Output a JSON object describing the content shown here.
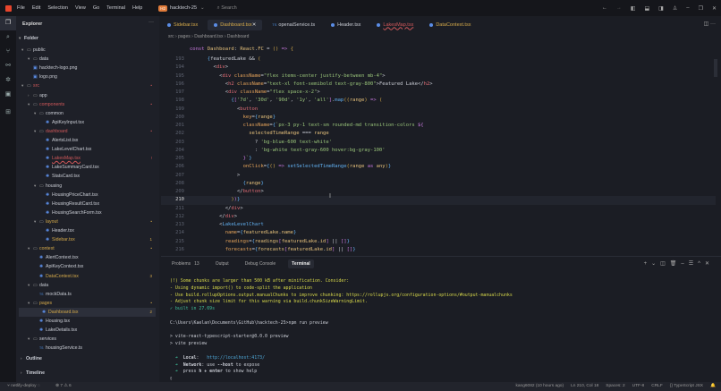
{
  "titlebar": {
    "menus": [
      "File",
      "Edit",
      "Selection",
      "View",
      "Go",
      "Terminal",
      "Help"
    ],
    "project_badge": "H2",
    "project": "hacktech-25",
    "search": "Search"
  },
  "explorer": {
    "title": "Explorer",
    "more": "···",
    "folder": "Folder",
    "outline": "Outline",
    "timeline": "Timeline",
    "rows": [
      {
        "d": 0,
        "t": "folder",
        "l": "public",
        "c": "#c9ccd4"
      },
      {
        "d": 1,
        "t": "folder",
        "l": "data",
        "c": "#c9ccd4"
      },
      {
        "d": 1,
        "t": "img",
        "l": "hacktech-logo.png",
        "c": "#c9ccd4"
      },
      {
        "d": 1,
        "t": "img",
        "l": "logo.png",
        "c": "#c9ccd4"
      },
      {
        "d": 0,
        "t": "folder",
        "l": "src",
        "c": "#d0585a",
        "b": "•"
      },
      {
        "d": 1,
        "t": "folderc",
        "l": "app",
        "c": "#c9ccd4"
      },
      {
        "d": 1,
        "t": "folder",
        "l": "components",
        "c": "#d0585a",
        "b": "•"
      },
      {
        "d": 2,
        "t": "folder",
        "l": "common",
        "c": "#c9ccd4"
      },
      {
        "d": 3,
        "t": "tsx",
        "l": "ApiKeyInput.tsx",
        "c": "#c9ccd4"
      },
      {
        "d": 2,
        "t": "folder",
        "l": "dashboard",
        "c": "#d0585a",
        "b": "•"
      },
      {
        "d": 3,
        "t": "tsx",
        "l": "AlertsList.tsx",
        "c": "#c9ccd4"
      },
      {
        "d": 3,
        "t": "tsx",
        "l": "LakeLevelChart.tsx",
        "c": "#c9ccd4"
      },
      {
        "d": 3,
        "t": "tsx",
        "l": "LakesMap.tsx",
        "c": "#d0585a",
        "b": "!"
      },
      {
        "d": 3,
        "t": "tsx",
        "l": "LakeSummaryCard.tsx",
        "c": "#c9ccd4"
      },
      {
        "d": 3,
        "t": "tsx",
        "l": "StatsCard.tsx",
        "c": "#c9ccd4"
      },
      {
        "d": 2,
        "t": "folder",
        "l": "housing",
        "c": "#c9ccd4"
      },
      {
        "d": 3,
        "t": "tsx",
        "l": "HousingPriceChart.tsx",
        "c": "#c9ccd4"
      },
      {
        "d": 3,
        "t": "tsx",
        "l": "HousingResultCard.tsx",
        "c": "#c9ccd4"
      },
      {
        "d": 3,
        "t": "tsx",
        "l": "HousingSearchForm.tsx",
        "c": "#c9ccd4"
      },
      {
        "d": 2,
        "t": "folder",
        "l": "layout",
        "c": "#d4a94a",
        "b": "•"
      },
      {
        "d": 3,
        "t": "tsx",
        "l": "Header.tsx",
        "c": "#c9ccd4"
      },
      {
        "d": 3,
        "t": "tsx",
        "l": "Sidebar.tsx",
        "c": "#d4a94a",
        "b": "1"
      },
      {
        "d": 1,
        "t": "folder",
        "l": "context",
        "c": "#d4a94a",
        "b": "•"
      },
      {
        "d": 2,
        "t": "tsx",
        "l": "AlertContext.tsx",
        "c": "#c9ccd4"
      },
      {
        "d": 2,
        "t": "tsx",
        "l": "ApiKeyContext.tsx",
        "c": "#c9ccd4"
      },
      {
        "d": 2,
        "t": "tsx",
        "l": "DataContext.tsx",
        "c": "#d4a94a",
        "b": "3"
      },
      {
        "d": 1,
        "t": "folder",
        "l": "data",
        "c": "#c9ccd4"
      },
      {
        "d": 2,
        "t": "ts",
        "l": "mockData.ts",
        "c": "#c9ccd4"
      },
      {
        "d": 1,
        "t": "folder",
        "l": "pages",
        "c": "#d4a94a",
        "b": "•"
      },
      {
        "d": 2,
        "t": "tsx",
        "l": "Dashboard.tsx",
        "c": "#d4a94a",
        "b": "2",
        "sel": true
      },
      {
        "d": 2,
        "t": "tsx",
        "l": "Housing.tsx",
        "c": "#c9ccd4"
      },
      {
        "d": 2,
        "t": "tsx",
        "l": "LakeDetails.tsx",
        "c": "#c9ccd4"
      },
      {
        "d": 1,
        "t": "folder",
        "l": "services",
        "c": "#c9ccd4"
      },
      {
        "d": 2,
        "t": "ts",
        "l": "housingService.ts",
        "c": "#c9ccd4"
      }
    ]
  },
  "tabs": [
    {
      "l": "Sidebar.tsx",
      "c": "#d4a94a",
      "i": "tsx"
    },
    {
      "l": "Dashboard.tsx",
      "c": "#d4a94a",
      "i": "tsx",
      "active": true
    },
    {
      "l": "openaiService.ts",
      "c": "#c9ccd4",
      "i": "ts"
    },
    {
      "l": "Header.tsx",
      "c": "#c9ccd4",
      "i": "tsx"
    },
    {
      "l": "LakesMap.tsx",
      "c": "#d0585a",
      "i": "tsx"
    },
    {
      "l": "DataContext.tsx",
      "c": "#d4a94a",
      "i": "tsx"
    }
  ],
  "breadcrumb": [
    "src",
    "pages",
    "Dashboard.tsx",
    "Dashboard"
  ],
  "code": {
    "sticky": [
      [
        "kw",
        "const "
      ],
      [
        "vr",
        "Dashboard"
      ],
      [
        "pl",
        ": "
      ],
      [
        "vr",
        "React"
      ],
      [
        "pl",
        "."
      ],
      [
        "vr",
        "FC"
      ],
      [
        "pl",
        " = "
      ],
      [
        "br",
        "()"
      ],
      [
        "kw",
        " => "
      ],
      [
        "br",
        "{"
      ]
    ],
    "lines": [
      {
        "n": "193",
        "i": 6,
        "t": [
          [
            "fn",
            "{"
          ],
          [
            "pl",
            "featuredLake && "
          ],
          [
            "br",
            "("
          ]
        ]
      },
      {
        "n": "194",
        "i": 8,
        "t": [
          [
            "pn",
            "<"
          ],
          [
            "tg",
            "div"
          ],
          [
            "pn",
            ">"
          ]
        ]
      },
      {
        "n": "195",
        "i": 10,
        "t": [
          [
            "pn",
            "<"
          ],
          [
            "tg",
            "div "
          ],
          [
            "at",
            "className"
          ],
          [
            "pn",
            "="
          ],
          [
            "st",
            "\"flex items-center justify-between mb-4\""
          ],
          [
            "pn",
            ">"
          ]
        ]
      },
      {
        "n": "196",
        "i": 12,
        "t": [
          [
            "pn",
            "<"
          ],
          [
            "tg",
            "h2 "
          ],
          [
            "at",
            "className"
          ],
          [
            "pn",
            "="
          ],
          [
            "st",
            "\"text-xl font-semibold text-gray-800\""
          ],
          [
            "pn",
            ">Featured Lake</"
          ],
          [
            "tg",
            "h2"
          ],
          [
            "pn",
            ">"
          ]
        ]
      },
      {
        "n": "197",
        "i": 12,
        "t": [
          [
            "pn",
            "<"
          ],
          [
            "tg",
            "div "
          ],
          [
            "at",
            "className"
          ],
          [
            "pn",
            "="
          ],
          [
            "st",
            "\"flex space-x-2\""
          ],
          [
            "pn",
            ">"
          ]
        ]
      },
      {
        "n": "198",
        "i": 14,
        "t": [
          [
            "fn",
            "{"
          ],
          [
            "kw",
            "["
          ],
          [
            "st",
            "'7d'"
          ],
          [
            "pl",
            ", "
          ],
          [
            "st",
            "'30d'"
          ],
          [
            "pl",
            ", "
          ],
          [
            "st",
            "'90d'"
          ],
          [
            "pl",
            ", "
          ],
          [
            "st",
            "'1y'"
          ],
          [
            "pl",
            ", "
          ],
          [
            "st",
            "'all'"
          ],
          [
            "kw",
            "]"
          ],
          [
            "pl",
            "."
          ],
          [
            "fn",
            "map"
          ],
          [
            "br",
            "(("
          ],
          [
            "vr",
            "range"
          ],
          [
            "br",
            ")"
          ],
          [
            "kw",
            " => "
          ],
          [
            "br",
            "("
          ]
        ]
      },
      {
        "n": "199",
        "i": 16,
        "t": [
          [
            "pn",
            "<"
          ],
          [
            "tg",
            "button"
          ]
        ]
      },
      {
        "n": "200",
        "i": 18,
        "t": [
          [
            "at",
            "key"
          ],
          [
            "pn",
            "="
          ],
          [
            "fn",
            "{"
          ],
          [
            "vr",
            "range"
          ],
          [
            "fn",
            "}"
          ]
        ]
      },
      {
        "n": "201",
        "i": 18,
        "t": [
          [
            "at",
            "className"
          ],
          [
            "pn",
            "="
          ],
          [
            "fn",
            "{"
          ],
          [
            "st",
            "`px-3 py-1 text-sm rounded-md transition-colors "
          ],
          [
            "kw",
            "${"
          ]
        ]
      },
      {
        "n": "202",
        "i": 20,
        "t": [
          [
            "vr",
            "selectedTimeRange"
          ],
          [
            "pl",
            " === "
          ],
          [
            "vr",
            "range"
          ]
        ]
      },
      {
        "n": "203",
        "i": 22,
        "t": [
          [
            "pl",
            "? "
          ],
          [
            "st",
            "'bg-blue-600 text-white'"
          ]
        ]
      },
      {
        "n": "204",
        "i": 22,
        "t": [
          [
            "pl",
            ": "
          ],
          [
            "st",
            "'bg-white text-gray-600 hover:bg-gray-100'"
          ]
        ]
      },
      {
        "n": "205",
        "i": 18,
        "t": [
          [
            "kw",
            "}"
          ],
          [
            "st",
            "`"
          ],
          [
            "fn",
            "}"
          ]
        ]
      },
      {
        "n": "206",
        "i": 18,
        "t": [
          [
            "at",
            "onClick"
          ],
          [
            "pn",
            "="
          ],
          [
            "fn",
            "{"
          ],
          [
            "br",
            "()"
          ],
          [
            "kw",
            " => "
          ],
          [
            "fn",
            "setSelectedTimeRange"
          ],
          [
            "br",
            "("
          ],
          [
            "vr",
            "range "
          ],
          [
            "kw",
            "as "
          ],
          [
            "vr",
            "any"
          ],
          [
            "br",
            ")"
          ],
          [
            "fn",
            "}"
          ]
        ]
      },
      {
        "n": "207",
        "i": 16,
        "t": [
          [
            "pn",
            ">"
          ]
        ]
      },
      {
        "n": "208",
        "i": 18,
        "t": [
          [
            "fn",
            "{"
          ],
          [
            "vr",
            "range"
          ],
          [
            "fn",
            "}"
          ]
        ]
      },
      {
        "n": "209",
        "i": 16,
        "t": [
          [
            "pn",
            "</"
          ],
          [
            "tg",
            "button"
          ],
          [
            "pn",
            ">"
          ]
        ]
      },
      {
        "n": "210",
        "i": 14,
        "t": [
          [
            "br",
            ")"
          ],
          [
            "kw",
            ")"
          ],
          [
            "fn",
            "}"
          ]
        ],
        "cur": true
      },
      {
        "n": "211",
        "i": 12,
        "t": [
          [
            "pn",
            "</"
          ],
          [
            "tg",
            "div"
          ],
          [
            "pn",
            ">"
          ]
        ]
      },
      {
        "n": "212",
        "i": 10,
        "t": [
          [
            "pn",
            "</"
          ],
          [
            "tg",
            "div"
          ],
          [
            "pn",
            ">"
          ]
        ]
      },
      {
        "n": "213",
        "i": 10,
        "t": [
          [
            "pn",
            "<"
          ],
          [
            "fn",
            "LakeLevelChart"
          ]
        ]
      },
      {
        "n": "214",
        "i": 12,
        "t": [
          [
            "at",
            "name"
          ],
          [
            "pn",
            "="
          ],
          [
            "fn",
            "{"
          ],
          [
            "vr",
            "featuredLake"
          ],
          [
            "pl",
            "."
          ],
          [
            "vr",
            "name"
          ],
          [
            "fn",
            "}"
          ]
        ]
      },
      {
        "n": "215",
        "i": 12,
        "t": [
          [
            "at",
            "readings"
          ],
          [
            "pn",
            "="
          ],
          [
            "fn",
            "{"
          ],
          [
            "vr",
            "readings"
          ],
          [
            "kw",
            "["
          ],
          [
            "vr",
            "featuredLake"
          ],
          [
            "pl",
            "."
          ],
          [
            "vr",
            "id"
          ],
          [
            "kw",
            "]"
          ],
          [
            "pl",
            " || "
          ],
          [
            "kw",
            "[]"
          ],
          [
            "fn",
            "}"
          ]
        ]
      },
      {
        "n": "216",
        "i": 12,
        "t": [
          [
            "at",
            "forecasts"
          ],
          [
            "pn",
            "="
          ],
          [
            "fn",
            "{"
          ],
          [
            "vr",
            "forecasts"
          ],
          [
            "kw",
            "["
          ],
          [
            "vr",
            "featuredLake"
          ],
          [
            "pl",
            "."
          ],
          [
            "vr",
            "id"
          ],
          [
            "kw",
            "]"
          ],
          [
            "pl",
            " || "
          ],
          [
            "kw",
            "[]"
          ],
          [
            "fn",
            "}"
          ]
        ]
      }
    ]
  },
  "panel": {
    "tabs": [
      {
        "l": "Problems",
        "badge": "13"
      },
      {
        "l": "Output"
      },
      {
        "l": "Debug Console"
      },
      {
        "l": "Terminal",
        "active": true
      }
    ],
    "terminal": [
      [
        [
          "y",
          "(!) Some chunks are larger than 500 kB after minification. Consider:"
        ]
      ],
      [
        [
          "y",
          "- Using dynamic import() to code-split the application"
        ]
      ],
      [
        [
          "y",
          "- Use build.rollupOptions.output.manualChunks to improve chunking: https://rollupjs.org/configuration-options/#output-manualchunks"
        ]
      ],
      [
        [
          "y",
          "- Adjust chunk size limit for this warning via build.chunkSizeWarningLimit."
        ]
      ],
      [
        [
          "g",
          "✓ built in 27.69s"
        ]
      ],
      [],
      [
        [
          "w",
          "C:\\Users\\Kaelan\\Documents\\GitHub\\hacktech-25>npm run preview"
        ]
      ],
      [],
      [
        [
          "w",
          "> vite-react-typescript-starter@0.0.0 preview"
        ]
      ],
      [
        [
          "w",
          "> vite preview"
        ]
      ],
      [],
      [
        [
          "g",
          "  ➜  "
        ],
        [
          "w b",
          "Local"
        ],
        [
          "w",
          ":   "
        ],
        [
          "c",
          "http://localhost:4173/"
        ]
      ],
      [
        [
          "g",
          "  ➜  "
        ],
        [
          "w b",
          "Network"
        ],
        [
          "w",
          ": use "
        ],
        [
          "w b",
          "--host"
        ],
        [
          "w",
          " to expose"
        ]
      ],
      [
        [
          "g",
          "  ➜  "
        ],
        [
          "w",
          "press "
        ],
        [
          "w b",
          "h + enter"
        ],
        [
          "w",
          " to show help"
        ]
      ],
      [
        [
          "w",
          "▯"
        ]
      ]
    ]
  },
  "status": {
    "branch": "netlify-deploy",
    "errors": "7",
    "warnings": "6",
    "blame": "kang6082 (10 hours ago)",
    "position": "Ln 210, Col 18",
    "spaces": "Spaces: 2",
    "encoding": "UTF-8",
    "eol": "CRLF",
    "language": "TypeScript JSX"
  }
}
